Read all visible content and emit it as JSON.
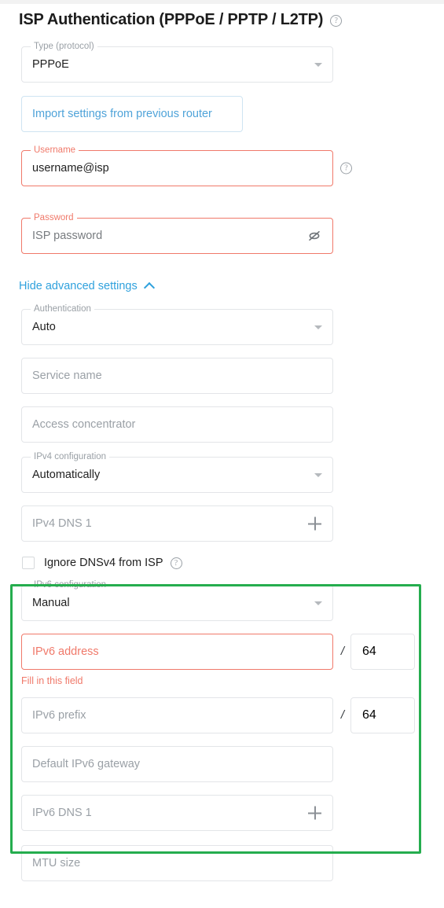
{
  "header": {
    "title": "ISP Authentication (PPPoE / PPTP / L2TP)",
    "help_icon": "help-circle-icon"
  },
  "form": {
    "type_protocol": {
      "legend": "Type (protocol)",
      "value": "PPPoE",
      "caret_icon": "chevron-down-icon"
    },
    "import_button": {
      "label": "Import settings from previous router"
    },
    "username": {
      "legend": "Username",
      "value": "username@isp",
      "help_icon": "help-circle-icon"
    },
    "password": {
      "legend": "Password",
      "placeholder": "ISP password",
      "reveal_icon": "eye-off-icon"
    },
    "advanced_toggle": {
      "label": "Hide advanced settings",
      "icon": "chevron-up-icon"
    },
    "authentication": {
      "legend": "Authentication",
      "value": "Auto",
      "caret_icon": "chevron-down-icon"
    },
    "service_name": {
      "placeholder": "Service name"
    },
    "access_concentrator": {
      "placeholder": "Access concentrator"
    },
    "ipv4_configuration": {
      "legend": "IPv4 configuration",
      "value": "Automatically",
      "caret_icon": "chevron-down-icon"
    },
    "ipv4_dns1": {
      "placeholder": "IPv4 DNS 1",
      "add_icon": "plus-icon"
    },
    "ignore_dnsv4": {
      "label": "Ignore DNSv4 from ISP",
      "checked": false,
      "help_icon": "help-circle-icon"
    },
    "ipv6_configuration": {
      "legend": "IPv6 configuration",
      "value": "Manual",
      "caret_icon": "chevron-down-icon"
    },
    "ipv6_address": {
      "placeholder": "IPv6 address",
      "separator": "/",
      "prefix_length": "64",
      "error": "Fill in this field"
    },
    "ipv6_prefix": {
      "placeholder": "IPv6 prefix",
      "separator": "/",
      "prefix_length": "64"
    },
    "ipv6_gateway": {
      "placeholder": "Default IPv6 gateway"
    },
    "ipv6_dns1": {
      "placeholder": "IPv6 DNS 1",
      "add_icon": "plus-icon"
    },
    "mtu_size": {
      "placeholder": "MTU size"
    }
  },
  "annotation": {
    "highlight_color": "#25ad4e"
  }
}
